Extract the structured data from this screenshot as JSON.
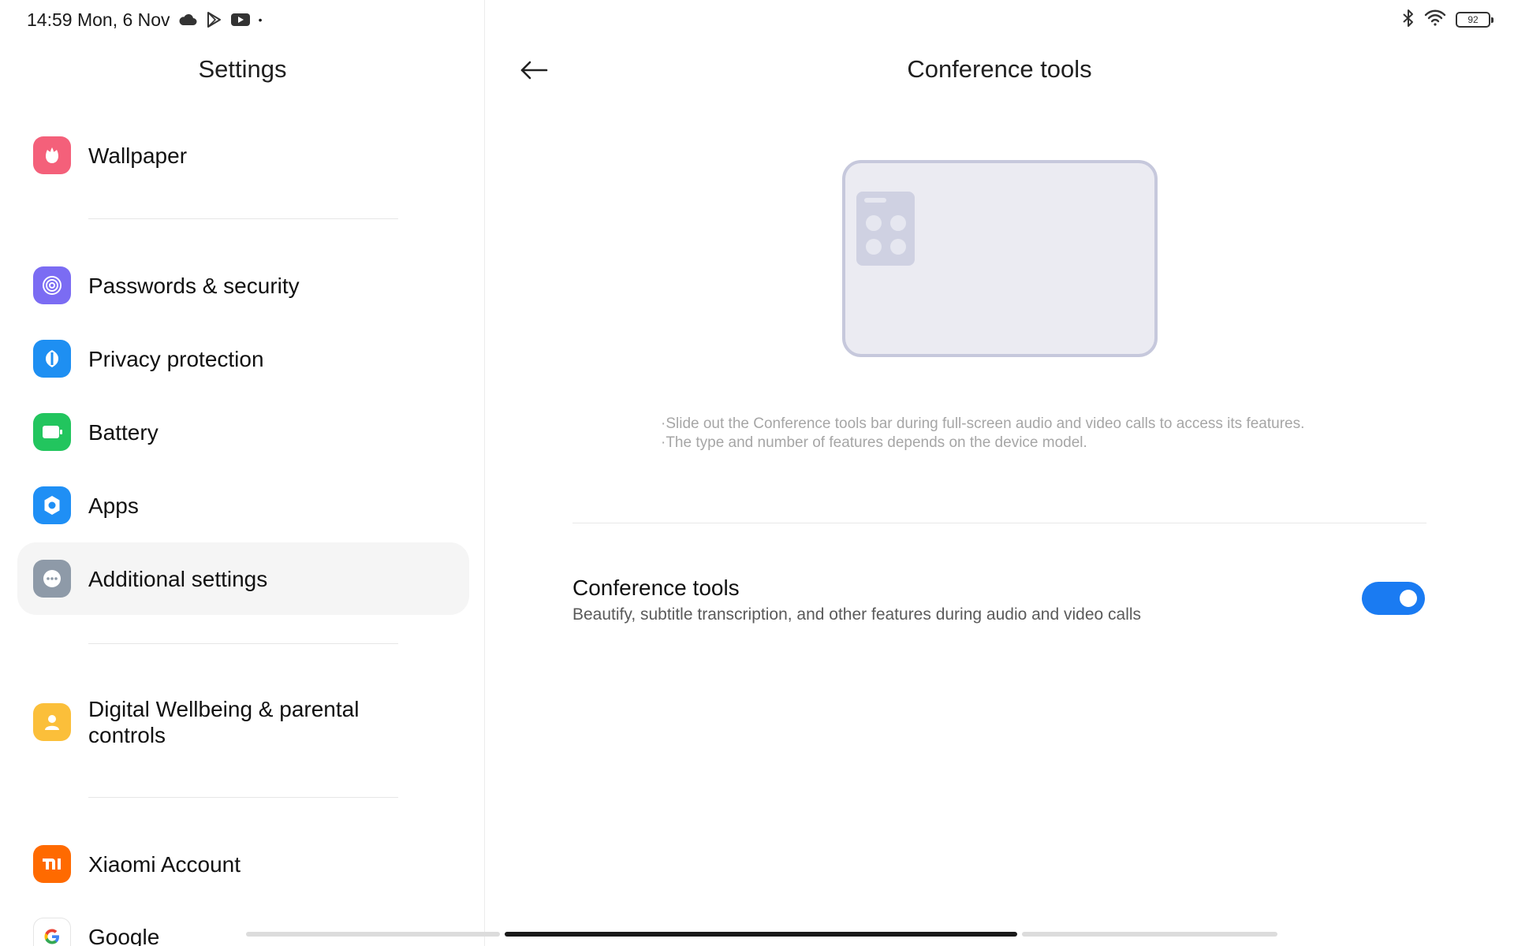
{
  "status_bar": {
    "time_date": "14:59 Mon, 6 Nov",
    "dot": "•",
    "battery_level": "92",
    "icons": [
      "cloud-icon",
      "play-store-icon",
      "youtube-icon",
      "bluetooth-icon",
      "wifi-icon",
      "battery-icon"
    ]
  },
  "left": {
    "title": "Settings",
    "items": [
      {
        "label": "Wallpaper",
        "icon": "wallpaper-icon",
        "color": "#f4607a"
      },
      {
        "label": "Passwords & security",
        "icon": "fingerprint-icon",
        "color": "#7b6cf3"
      },
      {
        "label": "Privacy protection",
        "icon": "privacy-icon",
        "color": "#1e8ff2"
      },
      {
        "label": "Battery",
        "icon": "battery-icon",
        "color": "#22c55e"
      },
      {
        "label": "Apps",
        "icon": "gear-icon",
        "color": "#1f8ff5"
      },
      {
        "label": "Additional settings",
        "icon": "more-icon",
        "color": "#8e9aa8",
        "selected": true
      },
      {
        "label": "Digital Wellbeing & parental controls",
        "icon": "wellbeing-icon",
        "color": "#fbbf3a"
      },
      {
        "label": "Xiaomi Account",
        "icon": "mi-icon",
        "color": "#ff6a00"
      },
      {
        "label": "Google",
        "icon": "google-icon",
        "color": "#ffffff"
      }
    ]
  },
  "right": {
    "title": "Conference tools",
    "description": [
      "·Slide out the Conference tools bar during full-screen audio and video calls to access its features.",
      "·The type and number of features depends on the device model."
    ],
    "setting": {
      "title": "Conference tools",
      "subtitle": "Beautify, subtitle transcription, and other features during audio and video calls",
      "enabled": true
    }
  },
  "colors": {
    "accent": "#1a7bf2",
    "selected_bg": "#f5f5f5"
  }
}
